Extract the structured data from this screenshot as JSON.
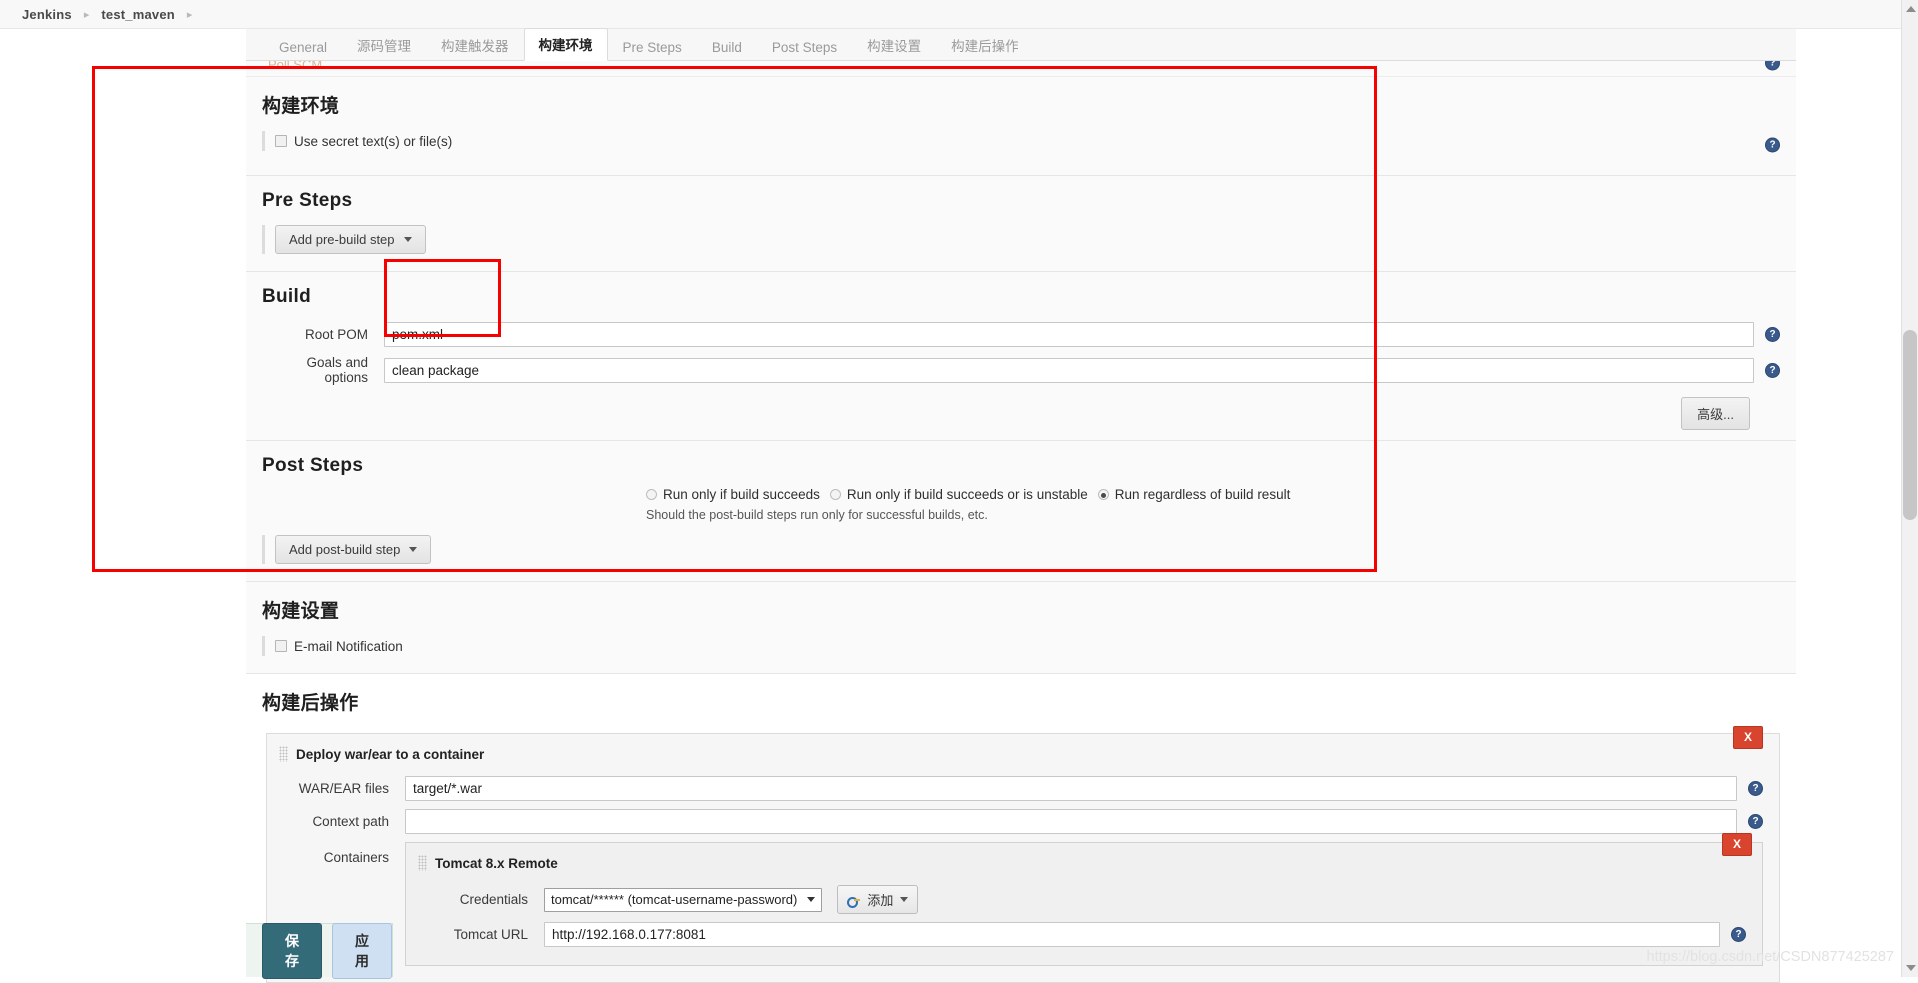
{
  "breadcrumb": {
    "items": [
      "Jenkins",
      "test_maven"
    ],
    "separator": "▸"
  },
  "tabs": [
    {
      "label": "General",
      "active": false
    },
    {
      "label": "源码管理",
      "active": false
    },
    {
      "label": "构建触发器",
      "active": false
    },
    {
      "label": "构建环境",
      "active": true
    },
    {
      "label": "Pre Steps",
      "active": false
    },
    {
      "label": "Build",
      "active": false
    },
    {
      "label": "Post Steps",
      "active": false
    },
    {
      "label": "构建设置",
      "active": false
    },
    {
      "label": "构建后操作",
      "active": false
    }
  ],
  "partial_top_row": {
    "label": "Poll SCM"
  },
  "build_environment": {
    "title": "构建环境",
    "checkbox_label": "Use secret text(s) or file(s)",
    "checked": false,
    "help": "?"
  },
  "pre_steps": {
    "title": "Pre Steps",
    "add_button": "Add pre-build step"
  },
  "build": {
    "title": "Build",
    "root_pom_label": "Root POM",
    "root_pom_value": "pom.xml",
    "goals_label": "Goals and options",
    "goals_value": "clean package",
    "advanced_button": "高级...",
    "help": "?"
  },
  "post_steps": {
    "title": "Post Steps",
    "options": [
      {
        "label": "Run only if build succeeds",
        "selected": false
      },
      {
        "label": "Run only if build succeeds or is unstable",
        "selected": false
      },
      {
        "label": "Run regardless of build result",
        "selected": true
      }
    ],
    "hint": "Should the post-build steps run only for successful builds, etc.",
    "add_button": "Add post-build step"
  },
  "build_settings": {
    "title": "构建设置",
    "checkbox_label": "E-mail Notification",
    "checked": false
  },
  "post_build_actions": {
    "title": "构建后操作",
    "deploy": {
      "header": "Deploy war/ear to a container",
      "remove_button": "X",
      "war_label": "WAR/EAR files",
      "war_value": "target/*.war",
      "context_label": "Context path",
      "context_value": "",
      "containers_label": "Containers",
      "container": {
        "header": "Tomcat 8.x Remote",
        "remove_button": "X",
        "credentials_label": "Credentials",
        "credentials_value": "tomcat/****** (tomcat-username-password)",
        "add_button": "添加",
        "tomcat_url_label": "Tomcat URL",
        "tomcat_url_value": "http://192.168.0.177:8081",
        "help": "?"
      }
    }
  },
  "footer": {
    "save_label": "保存",
    "apply_label": "应用"
  },
  "watermark": "https://blog.csdn.net/CSDN877425287",
  "colors": {
    "accent": "#336b79",
    "apply": "#cfe0f2",
    "danger": "#d9442f",
    "annotation": "#f70000",
    "help": "#3a5a8c"
  }
}
